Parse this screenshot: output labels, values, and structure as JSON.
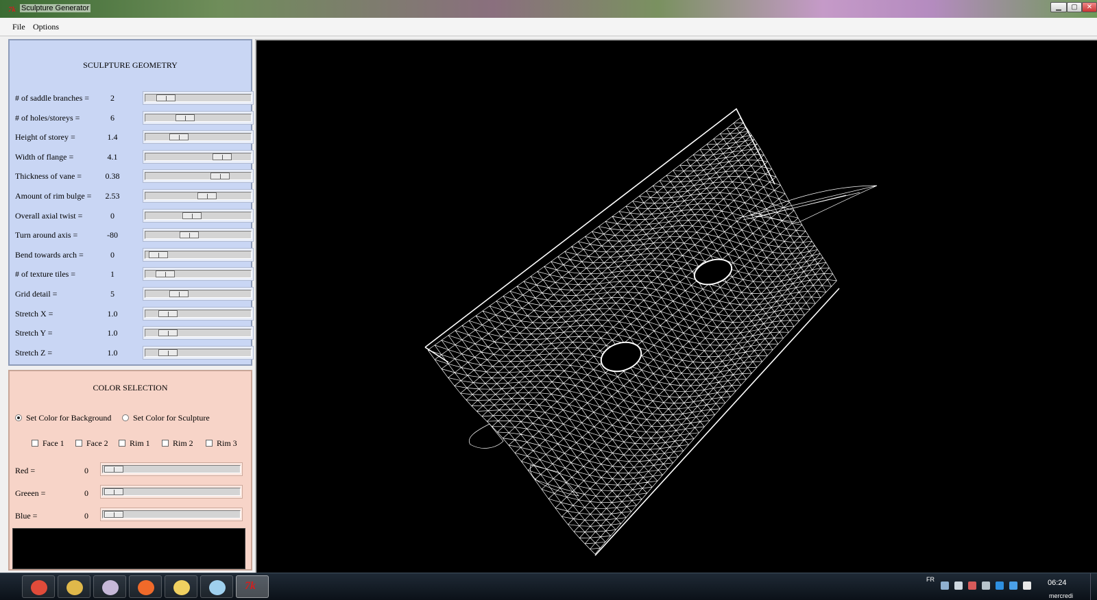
{
  "window": {
    "title": "Sculpture Generator",
    "app_icon": "tk-feather-icon",
    "controls": [
      "minimize-icon",
      "maximize-icon",
      "close-icon"
    ]
  },
  "menu": {
    "file": "File",
    "options": "Options"
  },
  "geometry": {
    "title": "SCULPTURE GEOMETRY",
    "params": [
      {
        "label": "# of saddle branches =",
        "value": "2",
        "level": 0.13
      },
      {
        "label": "# of holes/storeys =",
        "value": "6",
        "level": 0.35
      },
      {
        "label": "Height of storey =",
        "value": "1.4",
        "level": 0.28
      },
      {
        "label": "Width of flange =",
        "value": "4.1",
        "level": 0.78
      },
      {
        "label": "Thickness of vane =",
        "value": "0.38",
        "level": 0.75
      },
      {
        "label": "Amount of rim bulge =",
        "value": "2.53",
        "level": 0.6
      },
      {
        "label": "Overall axial twist =",
        "value": "0",
        "level": 0.43
      },
      {
        "label": "Turn around axis =",
        "value": "-80",
        "level": 0.4
      },
      {
        "label": "Bend towards arch =",
        "value": "0",
        "level": 0.04
      },
      {
        "label": "# of texture tiles =",
        "value": "1",
        "level": 0.12
      },
      {
        "label": "Grid detail =",
        "value": "5",
        "level": 0.28
      },
      {
        "label": "Stretch X =",
        "value": "1.0",
        "level": 0.15
      },
      {
        "label": "Stretch Y =",
        "value": "1.0",
        "level": 0.15
      },
      {
        "label": "Stretch Z =",
        "value": "1.0",
        "level": 0.15
      }
    ]
  },
  "color": {
    "title": "COLOR SELECTION",
    "radio_background": "Set Color for Background",
    "radio_sculpture": "Set Color for Sculpture",
    "selected": "background",
    "checks": [
      "Face 1",
      "Face 2",
      "Rim 1",
      "Rim 2",
      "Rim 3"
    ],
    "rgb": [
      {
        "label": "Red =",
        "value": "0",
        "level": 0.0
      },
      {
        "label": "Greeen =",
        "value": "0",
        "level": 0.0
      },
      {
        "label": "Blue =",
        "value": "0",
        "level": 0.0
      }
    ],
    "preview_color": "#000000",
    "panel_colors": {
      "geometry_bg": "#c9d6f4",
      "color_bg": "#f7d4c8"
    }
  },
  "viewport": {
    "background": "#000000",
    "wire_color": "#ffffff"
  },
  "taskbar": {
    "apps": [
      "chrome-icon",
      "file-explorer-icon",
      "paint-icon",
      "firefox-icon",
      "folder-icon",
      "notepad-icon",
      "tk-feather-icon"
    ],
    "active_app": 6,
    "lang": "FR",
    "time": "06:24",
    "day": "mercredi"
  }
}
